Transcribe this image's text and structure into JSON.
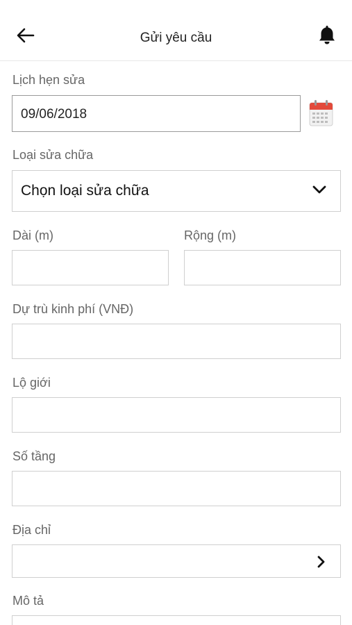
{
  "header": {
    "title": "Gửi yêu cầu",
    "back_icon": "arrow-left-icon",
    "notification_icon": "bell-icon"
  },
  "form": {
    "appointment": {
      "label": "Lịch hẹn sửa",
      "value": "09/06/2018",
      "icon": "calendar-icon"
    },
    "repair_type": {
      "label": "Loại sửa chữa",
      "selected": "Chọn loại sửa chữa",
      "icon": "chevron-down-icon"
    },
    "length": {
      "label": "Dài (m)",
      "value": ""
    },
    "width": {
      "label": "Rộng (m)",
      "value": ""
    },
    "budget": {
      "label": "Dự trù kinh phí (VNĐ)",
      "value": ""
    },
    "road_boundary": {
      "label": "Lộ giới",
      "value": ""
    },
    "floors": {
      "label": "Số tầng",
      "value": ""
    },
    "address": {
      "label": "Địa chỉ",
      "value": "",
      "icon": "chevron-right-icon"
    },
    "description": {
      "label": "Mô tả",
      "value": ""
    }
  },
  "colors": {
    "calendar_red": "#e24a3b",
    "border": "#cfcfcf",
    "label": "#666666"
  }
}
